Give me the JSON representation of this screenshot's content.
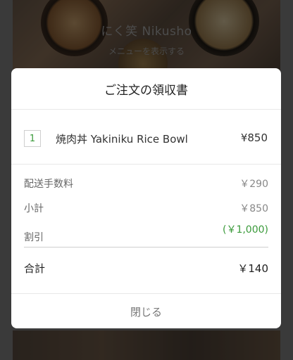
{
  "background": {
    "restaurant_name": "にく笑 Nikusho",
    "menu_link": "メニューを表示する"
  },
  "receipt": {
    "title": "ご注文の領収書",
    "items": [
      {
        "quantity": "1",
        "name": "焼肉丼 Yakiniku Rice Bowl",
        "price": "¥850"
      }
    ],
    "summary": {
      "delivery_fee_label": "配送手数料",
      "delivery_fee_value": "￥290",
      "subtotal_label": "小計",
      "subtotal_value": "￥850",
      "discount_label": "割引",
      "discount_value": "(￥1,000)"
    },
    "total_label": "合計",
    "total_value": "￥140",
    "close_label": "閉じる"
  },
  "colors": {
    "accent_green": "#3a9a3a",
    "overlay": "#3a3a3a"
  }
}
